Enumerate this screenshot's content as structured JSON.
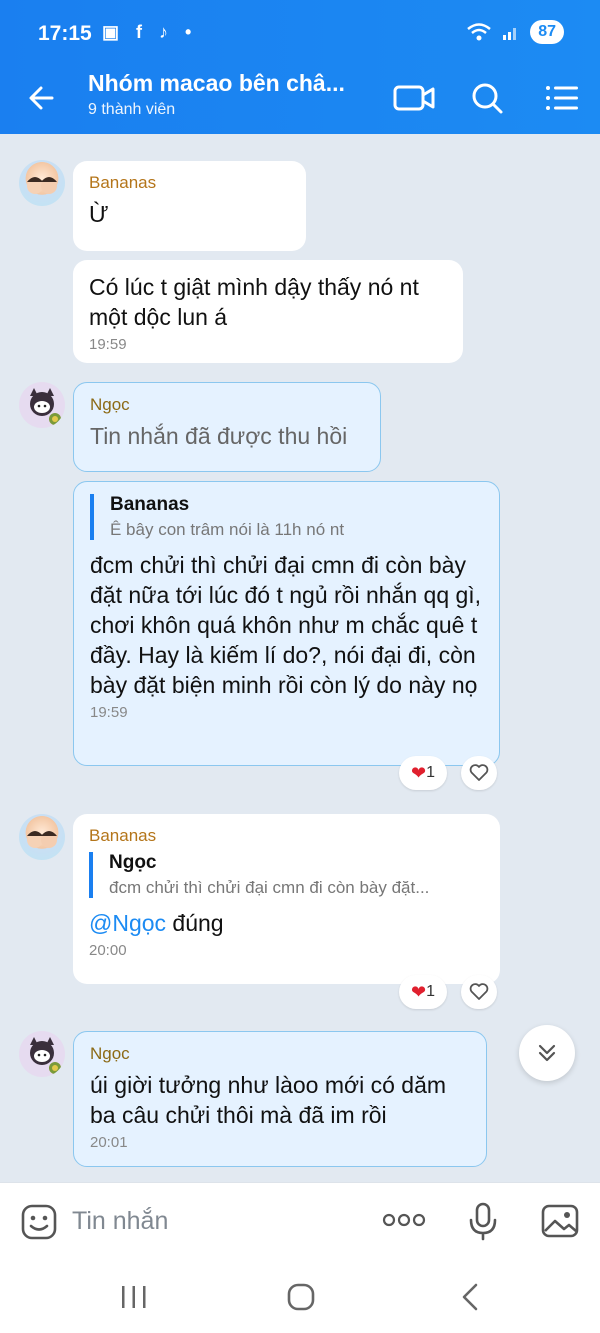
{
  "status_bar": {
    "time": "17:15",
    "notification_icons": "▣ f ♪ •",
    "battery": "87"
  },
  "header": {
    "title": "Nhóm macao bên châ...",
    "subtitle": "9 thành viên"
  },
  "messages": [
    {
      "sender": "Bananas",
      "text": "Ừ"
    },
    {
      "text": "Có lúc t giật mình dậy thấy nó nt một dộc lun á",
      "time": "19:59"
    },
    {
      "sender": "Ngọc",
      "text": "Tin nhắn đã được thu hồi"
    },
    {
      "quote_name": "Bananas",
      "quote_text": "Ê bây con trâm nói là 11h nó nt",
      "text": "đcm chửi thì chửi đại cmn đi còn bày đặt nữa tới lúc đó t ngủ rồi nhắn qq gì, chơi khôn quá khôn như m chắc quê t đầy. Hay là kiếm lí do?, nói đại đi, còn bày đặt biện minh rồi còn lý do này nọ",
      "time": "19:59",
      "reaction_count": "1"
    },
    {
      "sender": "Bananas",
      "quote_name": "Ngọc",
      "quote_text": "đcm chửi thì chửi đại cmn đi còn bày đặt...",
      "mention": "@Ngọc",
      "text": " đúng",
      "time": "20:00",
      "reaction_count": "1"
    },
    {
      "sender": "Ngọc",
      "text": "úi giời tưởng như làoo mới có dăm ba câu chửi thôi mà đã im rồi",
      "time": "20:01"
    }
  ],
  "input": {
    "placeholder": "Tin nhắn"
  },
  "colors": {
    "header": "#1c8bf3",
    "own_bubble": "#e5f2ff",
    "mention": "#1c8bf3"
  }
}
